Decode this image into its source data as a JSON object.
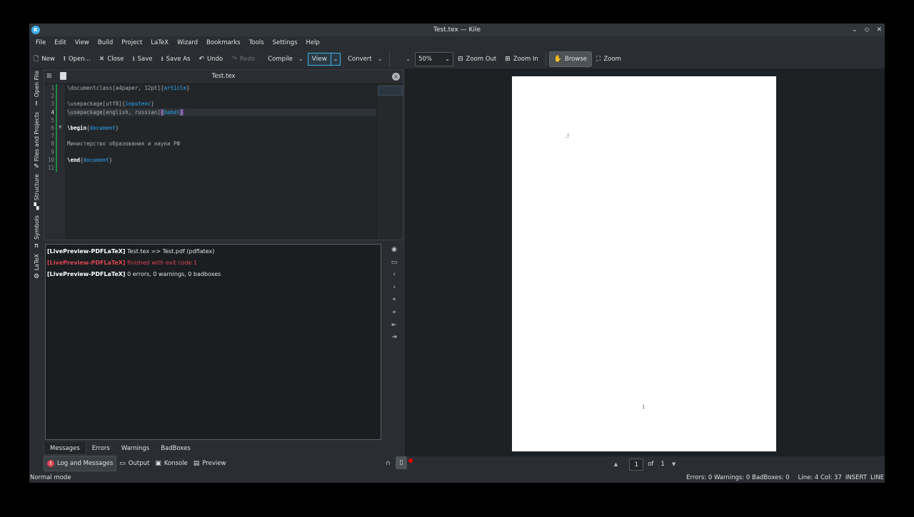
{
  "window": {
    "title": "Test.tex — Kile",
    "app_icon": "K",
    "controls": [
      "⌄",
      "◇",
      "✕"
    ]
  },
  "menu": [
    "File",
    "Edit",
    "View",
    "Build",
    "Project",
    "LaTeX",
    "Wizard",
    "Bookmarks",
    "Tools",
    "Settings",
    "Help"
  ],
  "toolbar": {
    "new": "New",
    "open": "Open...",
    "close": "Close",
    "save": "Save",
    "save_as": "Save As",
    "undo": "Undo",
    "redo": "Redo",
    "compile": "Compile",
    "view": "View",
    "convert": "Convert",
    "zoom_value": "50%",
    "zoom_out": "Zoom Out",
    "zoom_in": "Zoom In",
    "browse": "Browse",
    "zoom": "Zoom"
  },
  "sidebar": {
    "tabs": [
      "Open File",
      "Files and Projects",
      "Structure",
      "Symbols",
      "LaTeX"
    ]
  },
  "editor": {
    "tab_title": "Test.tex",
    "current_line": 4
  },
  "log": {
    "lines": [
      {
        "prefix": "[LivePreview-PDFLaTeX]",
        "text": " Test.tex => Test.pdf (pdflatex)",
        "error": false
      },
      {
        "prefix": "[LivePreview-PDFLaTeX]",
        "text": " finished with exit code 1",
        "error": true
      },
      {
        "prefix": "[LivePreview-PDFLaTeX]",
        "text": " 0 errors, 0 warnings, 0 badboxes",
        "error": false
      }
    ],
    "tabs": [
      "Messages",
      "Errors",
      "Warnings",
      "BadBoxes"
    ]
  },
  "bottom_tabs": {
    "log": "Log and Messages",
    "output": "Output",
    "konsole": "Konsole",
    "preview": "Preview"
  },
  "status": {
    "mode": "Normal mode",
    "counts": "Errors: 0  Warnings: 0  BadBoxes: 0",
    "position": "Line: 4 Col: 37",
    "insert": "INSERT",
    "line_mode": "LINE"
  },
  "viewer": {
    "page_mark": ".!",
    "page_number": "1",
    "current_page": "1",
    "of_label": "of",
    "total_pages": "1"
  }
}
